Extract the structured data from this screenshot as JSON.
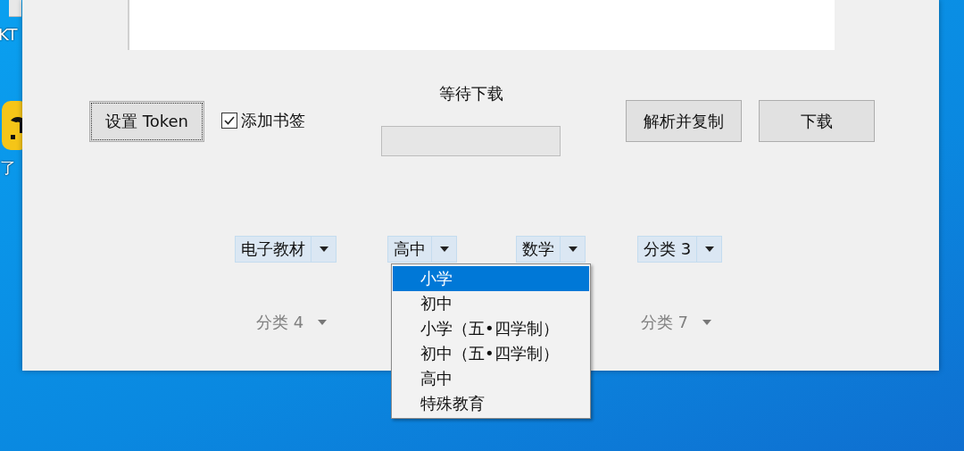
{
  "desktop_labels": [
    "KT",
    "了"
  ],
  "window": {
    "token_button": {
      "label": "设置 Token",
      "focused": true
    },
    "bookmark_checkbox": {
      "label": "添加书签",
      "checked": true
    },
    "status": {
      "label": "等待下载",
      "level": 0
    },
    "action_buttons": [
      {
        "label": "解析并复制"
      },
      {
        "label": "下载"
      }
    ],
    "filters": [
      {
        "value": "电子教材",
        "disabled": false
      },
      {
        "value": "高中",
        "disabled": false
      },
      {
        "value": "数学",
        "disabled": false
      },
      {
        "value": "分类 3",
        "disabled": false
      }
    ],
    "filters_row2": [
      {
        "value": "分类 4",
        "disabled": true
      },
      {
        "value": "分类 7",
        "disabled": true
      }
    ],
    "dropdown_list": {
      "options": [
        {
          "label": "小学",
          "selected": true
        },
        {
          "label": "初中",
          "selected": false
        },
        {
          "label": "小学（五•四学制）",
          "selected": false
        },
        {
          "label": "初中（五•四学制）",
          "selected": false
        },
        {
          "label": "高中",
          "selected": false
        },
        {
          "label": "特殊教育",
          "selected": false
        }
      ]
    }
  }
}
